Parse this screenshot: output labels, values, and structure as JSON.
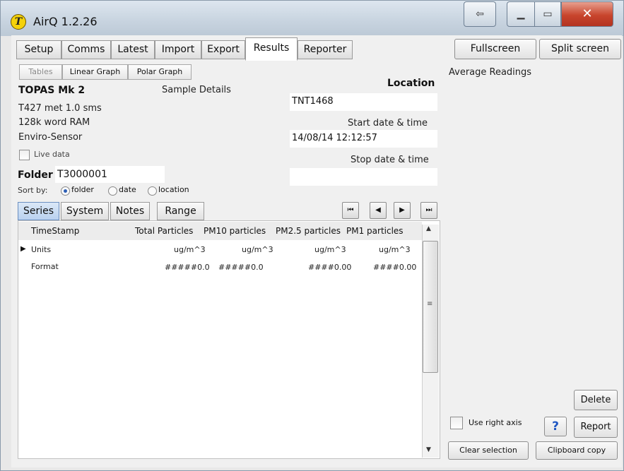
{
  "window": {
    "title": "AirQ 1.2.26",
    "minimize_icon": "minimize-icon",
    "maximize_icon": "maximize-icon",
    "close_icon": "close-icon",
    "extra_icon": "restore-arrow-icon"
  },
  "toolbar": {
    "tabs": [
      {
        "label": "Setup"
      },
      {
        "label": "Comms"
      },
      {
        "label": "Latest"
      },
      {
        "label": "Import"
      },
      {
        "label": "Export"
      },
      {
        "label": "Results",
        "active": true
      },
      {
        "label": "Reporter"
      }
    ],
    "fullscreen_label": "Fullscreen",
    "split_screen_label": "Split screen"
  },
  "view_tabs": [
    {
      "label": "Tables",
      "disabled": true
    },
    {
      "label": "Linear Graph"
    },
    {
      "label": "Polar Graph"
    }
  ],
  "device": {
    "name": "TOPAS Mk 2",
    "line1": "T427 met 1.0 sms",
    "line2": "128k word RAM",
    "line3": "Enviro-Sensor",
    "live_data_label": "Live data",
    "sample_details_label": "Sample Details"
  },
  "location": {
    "label": "Location",
    "value": "TNT1468"
  },
  "start": {
    "label": "Start date & time",
    "value": "14/08/14 12:12:57"
  },
  "stop": {
    "label": "Stop date & time",
    "value": ""
  },
  "folder": {
    "label": "Folder",
    "value": "T3000001"
  },
  "sort": {
    "label": "Sort by:",
    "options": [
      {
        "label": "folder",
        "selected": true
      },
      {
        "label": "date"
      },
      {
        "label": "location"
      }
    ]
  },
  "bottom_tabs": [
    {
      "label": "Series",
      "active": true
    },
    {
      "label": "System"
    },
    {
      "label": "Notes"
    },
    {
      "label": "Range"
    }
  ],
  "nav": {
    "first": "⏮",
    "prev": "◀",
    "next": "▶",
    "last": "⏭"
  },
  "grid": {
    "columns": [
      "TimeStamp",
      "Total Particles",
      "PM10 particles",
      "PM2.5 particles",
      "PM1 particles"
    ],
    "rows": [
      {
        "label": "Units",
        "current": true,
        "values": [
          "ug/m^3",
          "ug/m^3",
          "ug/m^3",
          "ug/m^3"
        ]
      },
      {
        "label": "Format",
        "values": [
          "#####0.0",
          "#####0.0",
          "####0.00",
          "####0.00"
        ]
      }
    ]
  },
  "right_panel": {
    "title": "Average Readings",
    "delete_label": "Delete",
    "use_right_axis_label": "Use right axis",
    "help_label": "?",
    "report_label": "Report",
    "clear_selection_label": "Clear selection",
    "clipboard_copy_label": "Clipboard copy"
  }
}
